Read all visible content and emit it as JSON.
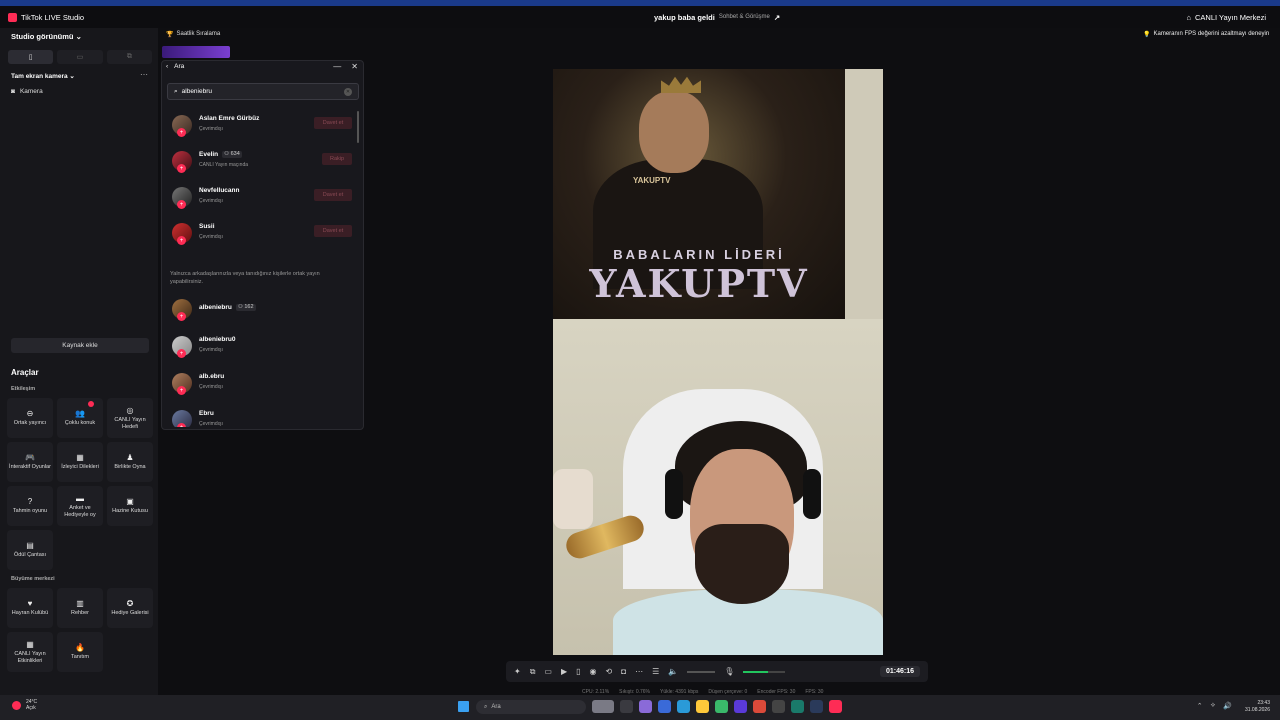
{
  "titlebar": {
    "app_name": "TikTok LIVE Studio",
    "stream_title": "yakup baba geldi",
    "stream_category": "Sohbet & Görüşme",
    "live_center": "CANLI Yayın Merkezi"
  },
  "sidebar": {
    "studio_view": "Studio görünümü",
    "scene_name": "Tam ekran kamera",
    "sources": [
      "Kamera"
    ],
    "add_source": "Kaynak ekle",
    "tools_title": "Araçlar",
    "section_interaction": "Etkileşim",
    "section_growth": "Büyüme merkezi",
    "tools": [
      {
        "label": "Ortak yayıncı",
        "icon": "link-icon"
      },
      {
        "label": "Çoklu konuk",
        "icon": "people-icon"
      },
      {
        "label": "CANLI Yayın Hedefi",
        "icon": "target-icon"
      },
      {
        "label": "İnteraktif Oyunlar",
        "icon": "gamepad-icon"
      },
      {
        "label": "İzleyici Dilekleri",
        "icon": "gift-icon"
      },
      {
        "label": "Birlikte Oyna",
        "icon": "controller-icon"
      },
      {
        "label": "Tahmin oyunu",
        "icon": "question-icon"
      },
      {
        "label": "Anket ve Hediyeyle oy",
        "icon": "poll-icon"
      },
      {
        "label": "Hazine Kutusu",
        "icon": "chest-icon"
      },
      {
        "label": "Ödül Çantası",
        "icon": "bag-icon"
      }
    ],
    "growth_tools": [
      {
        "label": "Hayran Kulübü",
        "icon": "heart-icon"
      },
      {
        "label": "Rehber",
        "icon": "book-icon"
      },
      {
        "label": "Hediye Galerisi",
        "icon": "gallery-icon"
      },
      {
        "label": "CANLI Yayın Etkinlikleri",
        "icon": "calendar-icon"
      },
      {
        "label": "Tanıtım",
        "icon": "fire-icon"
      }
    ]
  },
  "main": {
    "rank_label": "Saatlik Sıralama",
    "tip": "Kameranın FPS değerini azaltmayı deneyin"
  },
  "dialog": {
    "back_label": "Ara",
    "search_value": "albeniebru",
    "note": "Yalnızca arkadaşlarınızla veya tanıdığınız kişilerle ortak yayın yapabilirsiniz.",
    "users": [
      {
        "name": "Aslan Emre Gürbüz",
        "count": "",
        "status": "Çevrimdışı",
        "action": "Davet et"
      },
      {
        "name": "Evelin",
        "count": "634",
        "status": "CANLI Yayın maçında",
        "action": "Rakip"
      },
      {
        "name": "Nevfellucann",
        "count": "",
        "status": "Çevrimdışı",
        "action": "Davet et"
      },
      {
        "name": "Susii",
        "count": "",
        "status": "Çevrimdışı",
        "action": "Davet et"
      }
    ],
    "results": [
      {
        "name": "albeniebru",
        "count": "162",
        "status": ""
      },
      {
        "name": "albeniebru0",
        "count": "",
        "status": "Çevrimdışı"
      },
      {
        "name": "alb.ebru",
        "count": "",
        "status": "Çevrimdışı"
      },
      {
        "name": "Ebru",
        "count": "",
        "status": "Çevrimdışı"
      }
    ]
  },
  "preview": {
    "poster_logo": "YAKUPTV",
    "poster_line1": "BABALARIN LİDERİ",
    "poster_line2": "YAKUPTV"
  },
  "controls": {
    "timer": "01:46:16"
  },
  "stats": {
    "cpu": "CPU: 2.11%",
    "bitrate": "Sıkıştı: 0.76%",
    "upload": "Yükle: 4391 kbps",
    "dropped": "Düşen çerçeve: 0",
    "encoder": "Encoder FPS: 30",
    "fps": "FPS: 30"
  },
  "taskbar": {
    "temp": "24°C",
    "weather": "Açık",
    "search": "Ara",
    "time": "23:43",
    "date": "31.08.2026"
  },
  "colors": {
    "accent": "#fe2c55",
    "background": "#111114"
  }
}
